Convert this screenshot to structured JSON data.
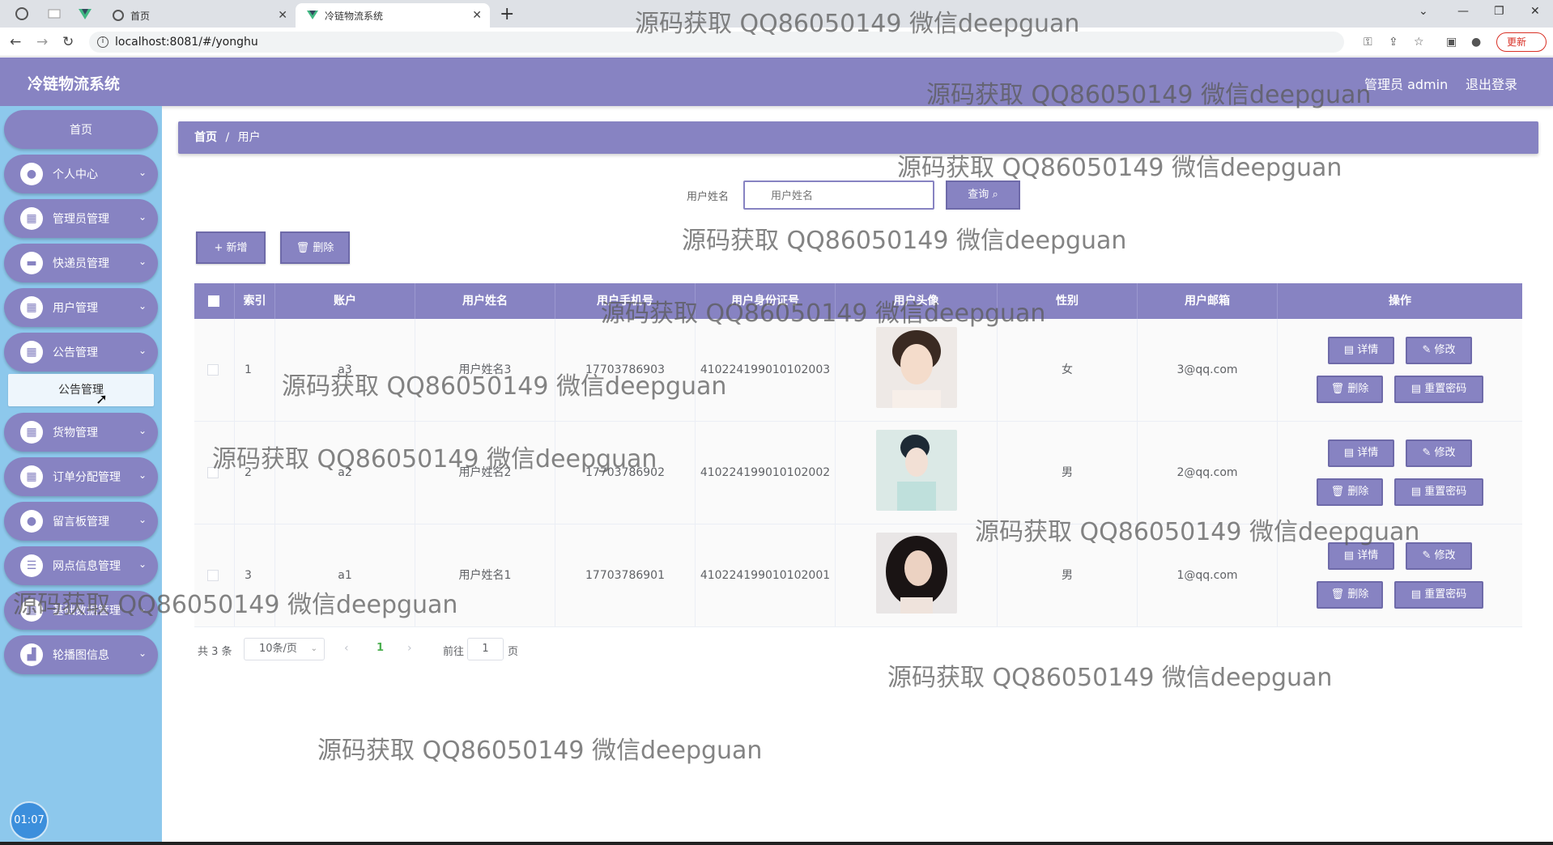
{
  "browser": {
    "tabs": [
      {
        "label": "首页"
      },
      {
        "label": "冷链物流系统"
      }
    ],
    "url": "localhost:8081/#/yonghu",
    "update_label": "更新"
  },
  "header": {
    "title": "冷链物流系统",
    "user": "管理员 admin",
    "logout": "退出登录"
  },
  "sidebar": {
    "items": [
      {
        "label": "首页",
        "icon": "home"
      },
      {
        "label": "个人中心",
        "icon": "user-icon"
      },
      {
        "label": "管理员管理",
        "icon": "grid-icon"
      },
      {
        "label": "快递员管理",
        "icon": "monitor-icon"
      },
      {
        "label": "用户管理",
        "icon": "grid-icon"
      },
      {
        "label": "公告管理",
        "icon": "grid-icon"
      },
      {
        "label": "货物管理",
        "icon": "grid-icon"
      },
      {
        "label": "订单分配管理",
        "icon": "grid-icon"
      },
      {
        "label": "留言板管理",
        "icon": "user-icon"
      },
      {
        "label": "网点信息管理",
        "icon": "sliders-icon"
      },
      {
        "label": "基础数据管理",
        "icon": "grid-icon"
      },
      {
        "label": "轮播图信息",
        "icon": "chart-icon"
      }
    ],
    "submenu": {
      "label": "公告管理"
    },
    "clock": "01:07"
  },
  "breadcrumb": {
    "home": "首页",
    "sep": "/",
    "current": "用户"
  },
  "search": {
    "label": "用户姓名",
    "placeholder": "用户姓名",
    "button": "查询"
  },
  "actions": {
    "add": "+ 新增",
    "delete": "删除"
  },
  "table": {
    "headers": [
      "",
      "索引",
      "账户",
      "用户姓名",
      "用户手机号",
      "用户身份证号",
      "用户头像",
      "性别",
      "用户邮箱",
      "操作"
    ],
    "rows": [
      {
        "index": "1",
        "account": "a3",
        "name": "用户姓名3",
        "phone": "17703786903",
        "id": "410224199010102003",
        "gender": "女",
        "email": "3@qq.com"
      },
      {
        "index": "2",
        "account": "a2",
        "name": "用户姓名2",
        "phone": "17703786902",
        "id": "410224199010102002",
        "gender": "男",
        "email": "2@qq.com"
      },
      {
        "index": "3",
        "account": "a1",
        "name": "用户姓名1",
        "phone": "17703786901",
        "id": "410224199010102001",
        "gender": "男",
        "email": "1@qq.com"
      }
    ],
    "ops": {
      "detail": "详情",
      "edit": "修改",
      "delete": "删除",
      "reset": "重置密码"
    }
  },
  "pagination": {
    "total": "共 3 条",
    "page_size": "10条/页",
    "current": "1",
    "goto": "前往",
    "goto_value": "1",
    "page": "页"
  },
  "watermark": "源码获取 QQ86050149 微信deepguan",
  "colors": {
    "primary": "#8783c2",
    "sidebar": "#8dc8ec"
  }
}
